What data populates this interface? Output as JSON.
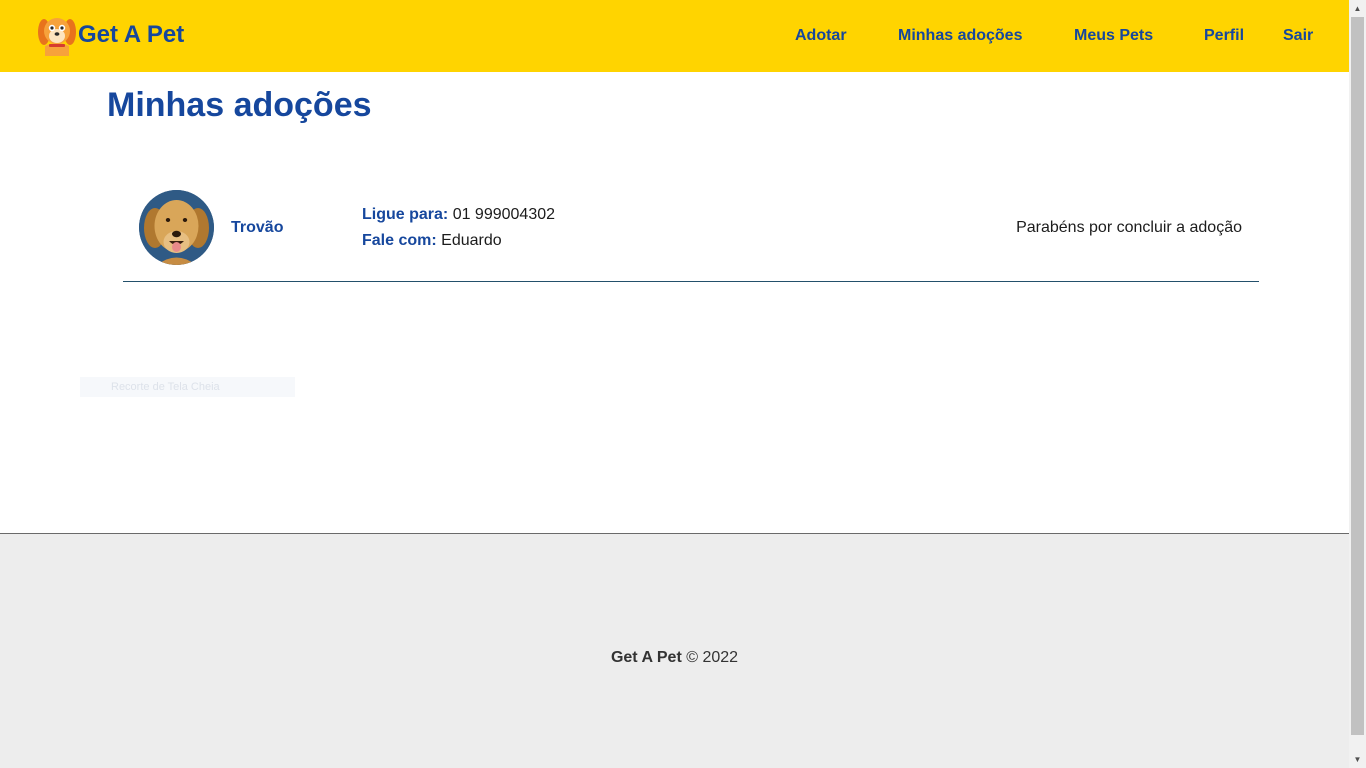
{
  "navbar": {
    "brand": "Get A Pet",
    "logo_icon": "dog-logo-icon",
    "links": [
      {
        "label": "Adotar"
      },
      {
        "label": "Minhas adoções"
      },
      {
        "label": "Meus Pets"
      },
      {
        "label": "Perfil"
      },
      {
        "label": "Sair"
      }
    ]
  },
  "main": {
    "title": "Minhas adoções",
    "adoptions": [
      {
        "pet_name": "Trovão",
        "phone_label": "Ligue para:",
        "phone": "01 999004302",
        "contact_label": "Fale com:",
        "contact_name": "Eduardo",
        "status": "Parabéns por concluir a adoção"
      }
    ],
    "ghost_text": "Recorte de Tela Cheia"
  },
  "footer": {
    "brand": "Get A Pet",
    "copyright": "© 2022"
  },
  "colors": {
    "navbar_bg": "#ffd400",
    "primary": "#16479d",
    "footer_bg": "#ededed"
  }
}
